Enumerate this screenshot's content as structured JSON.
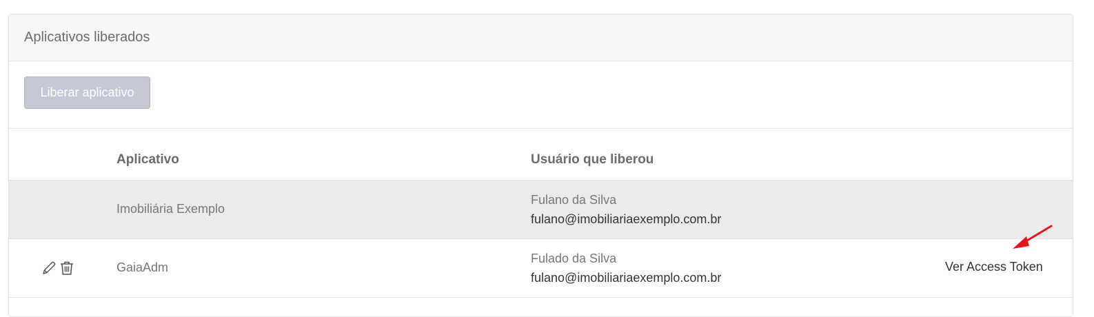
{
  "panel": {
    "title": "Aplicativos liberados"
  },
  "toolbar": {
    "liberar_label": "Liberar aplicativo"
  },
  "table": {
    "columns": {
      "aplicativo": "Aplicativo",
      "usuario": "Usuário que liberou"
    },
    "rows": [
      {
        "aplicativo": "Imobiliária Exemplo",
        "usuario_nome": "Fulano da Silva",
        "usuario_email": "fulano@imobiliariaexemplo.com.br",
        "has_actions": false
      },
      {
        "aplicativo": "GaiaAdm",
        "usuario_nome": "Fulado da Silva",
        "usuario_email": "fulano@imobiliariaexemplo.com.br",
        "has_actions": true,
        "token_link": "Ver Access Token",
        "actions": [
          "pencil-icon",
          "trash-icon"
        ]
      }
    ]
  },
  "annotation": {
    "arrow_color": "#e8141c"
  },
  "colors": {
    "button_bg": "#c4c9d5",
    "shaded_row": "#ebebeb",
    "header_bg": "#f7f7f7"
  }
}
